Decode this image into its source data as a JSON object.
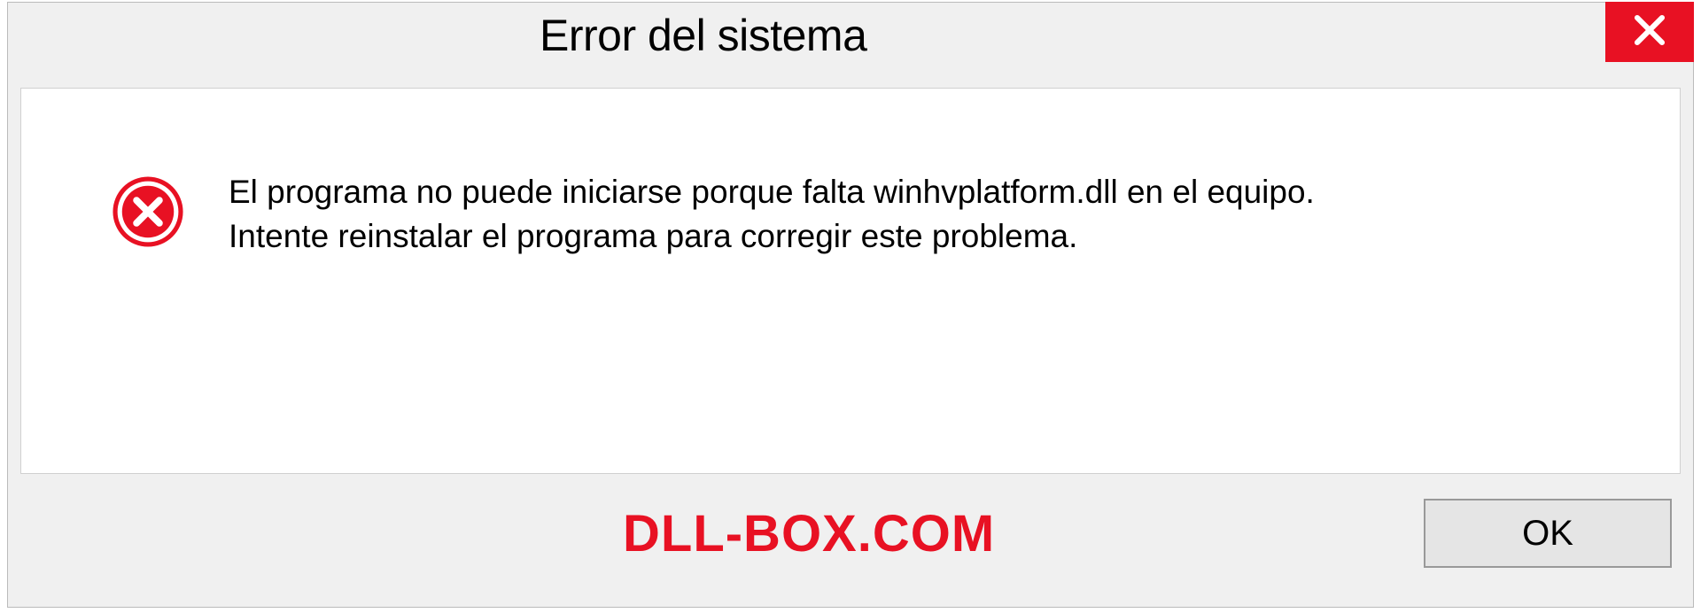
{
  "titlebar": {
    "title": "Error del sistema"
  },
  "message": {
    "line1": "El programa no puede iniciarse porque falta winhvplatform.dll en el equipo.",
    "line2": "Intente reinstalar el programa para corregir este problema."
  },
  "footer": {
    "watermark": "DLL-BOX.COM",
    "ok_label": "OK"
  },
  "colors": {
    "error_red": "#e81123",
    "panel_bg": "#f0f0f0"
  }
}
